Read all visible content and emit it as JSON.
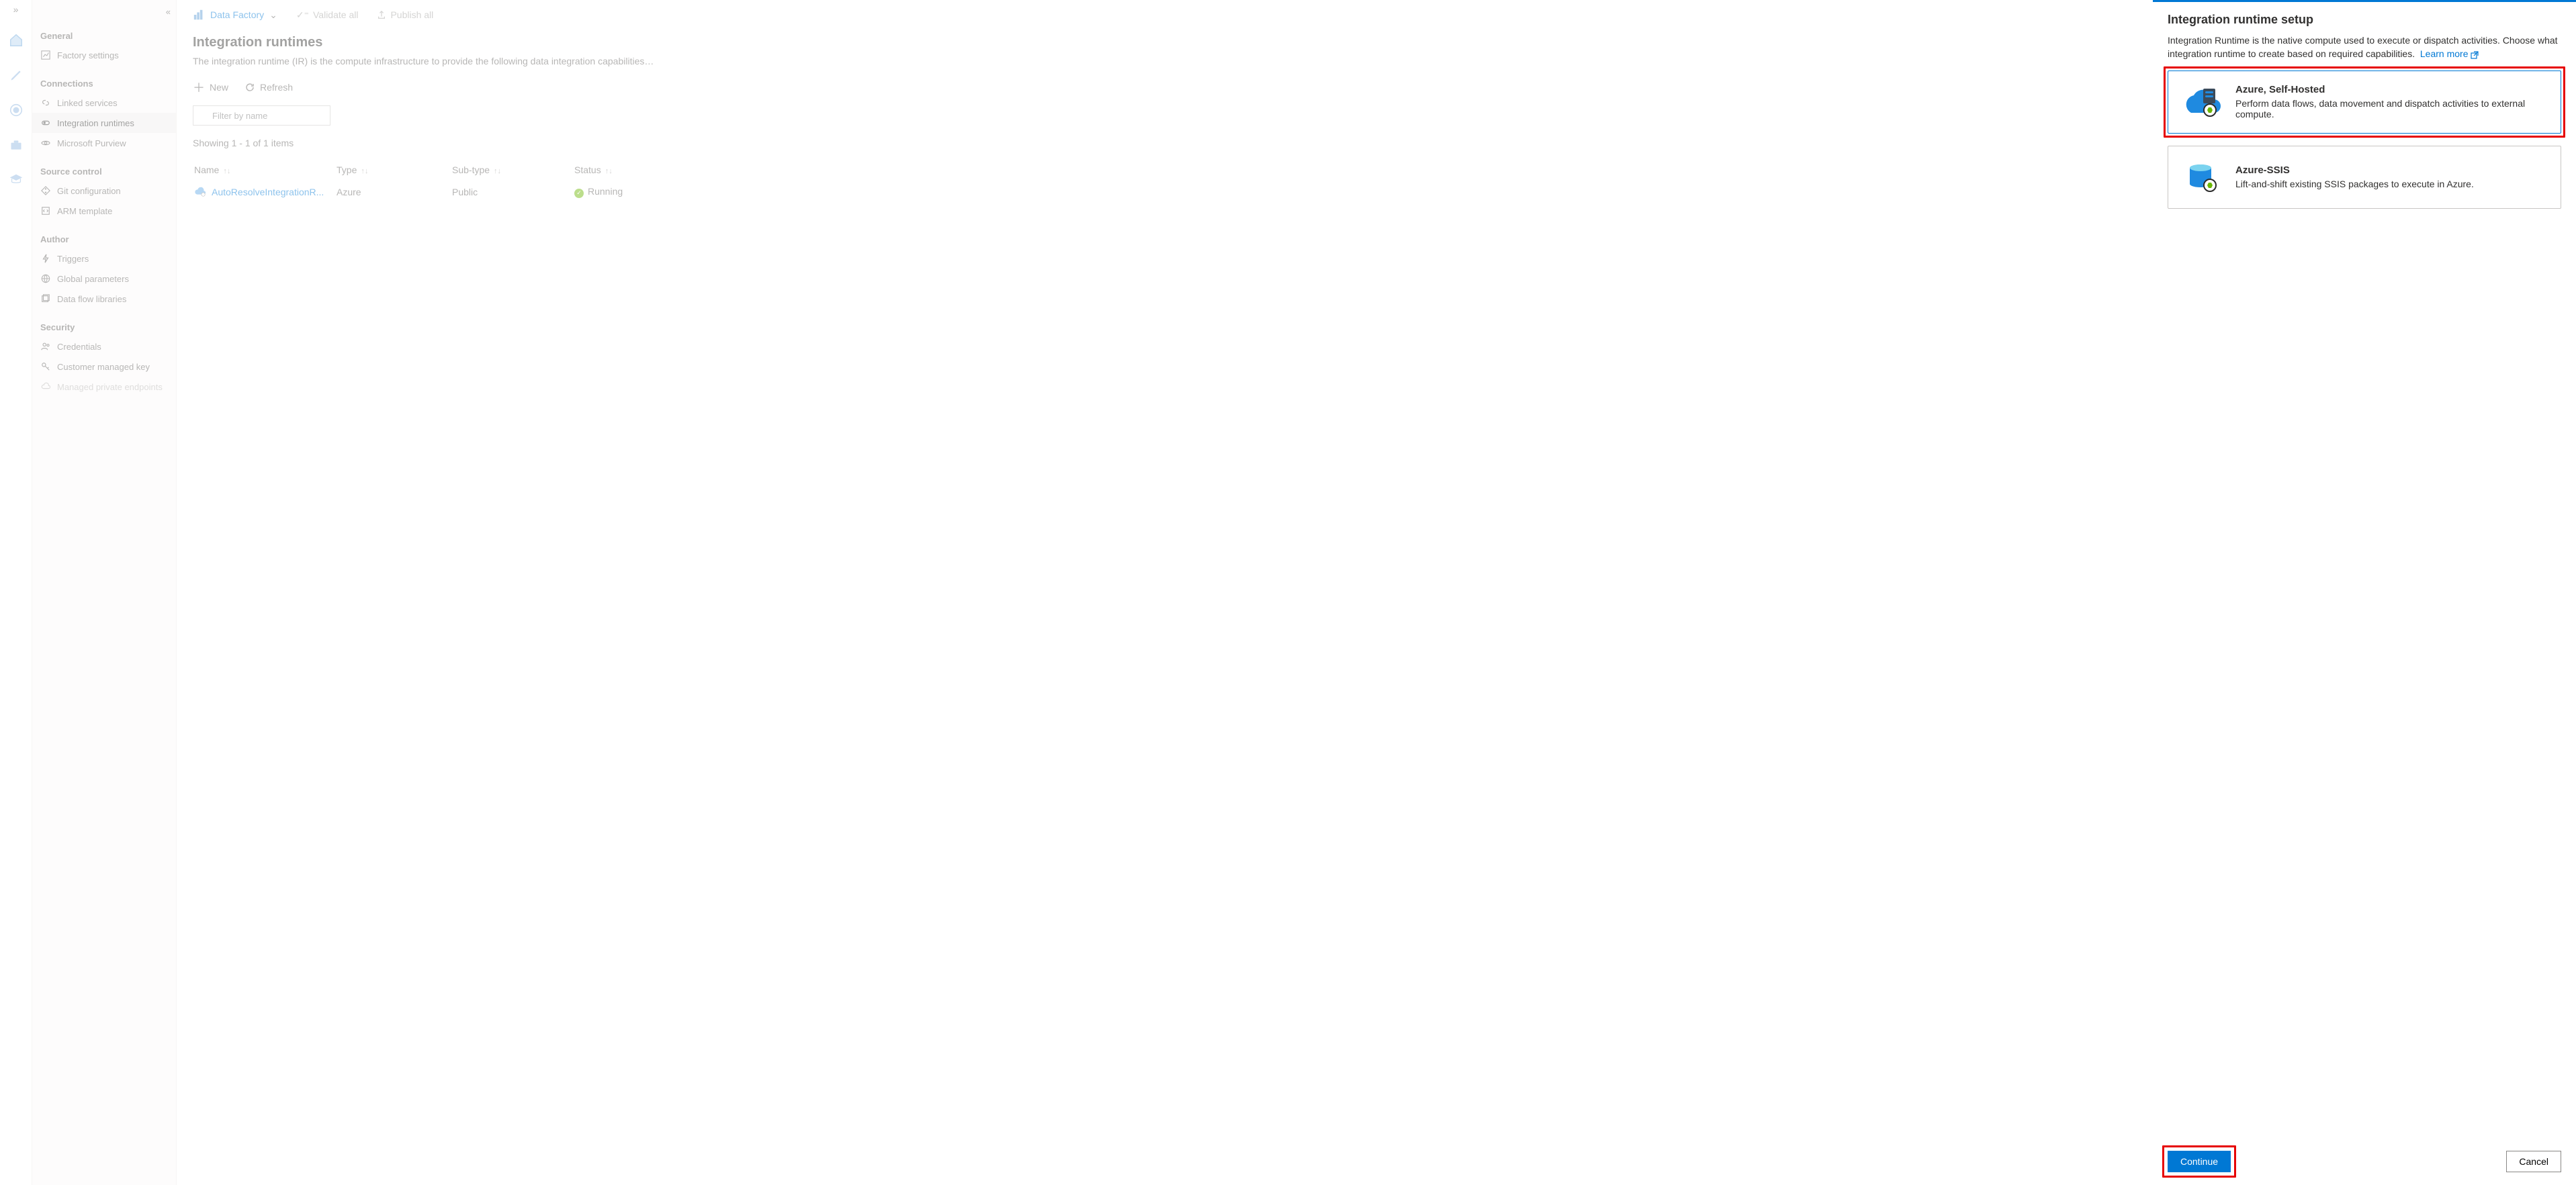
{
  "topbar": {
    "brand": "Data Factory",
    "validate": "Validate all",
    "publish": "Publish all"
  },
  "sidebar": {
    "groups": [
      {
        "header": "General",
        "items": [
          {
            "label": "Factory settings"
          }
        ]
      },
      {
        "header": "Connections",
        "items": [
          {
            "label": "Linked services"
          },
          {
            "label": "Integration runtimes",
            "selected": true
          },
          {
            "label": "Microsoft Purview"
          }
        ]
      },
      {
        "header": "Source control",
        "items": [
          {
            "label": "Git configuration"
          },
          {
            "label": "ARM template"
          }
        ]
      },
      {
        "header": "Author",
        "items": [
          {
            "label": "Triggers"
          },
          {
            "label": "Global parameters"
          },
          {
            "label": "Data flow libraries"
          }
        ]
      },
      {
        "header": "Security",
        "items": [
          {
            "label": "Credentials"
          },
          {
            "label": "Customer managed key"
          },
          {
            "label": "Managed private endpoints",
            "disabled": true
          }
        ]
      }
    ]
  },
  "main": {
    "title": "Integration runtimes",
    "subtitle": "The integration runtime (IR) is the compute infrastructure to provide the following data integration capabilities…",
    "new": "New",
    "refresh": "Refresh",
    "filter_placeholder": "Filter by name",
    "showing": "Showing 1 - 1 of 1 items",
    "columns": {
      "name": "Name",
      "type": "Type",
      "subtype": "Sub-type",
      "status": "Status"
    },
    "row": {
      "name": "AutoResolveIntegrationR...",
      "type": "Azure",
      "subtype": "Public",
      "status": "Running"
    }
  },
  "panel": {
    "title": "Integration runtime setup",
    "desc_a": "Integration Runtime is the native compute used to execute or dispatch activities. Choose what integration runtime to create based on required capabilities.",
    "learn": "Learn more",
    "cards": [
      {
        "title": "Azure, Self-Hosted",
        "sub": "Perform data flows, data movement and dispatch activities to external compute."
      },
      {
        "title": "Azure-SSIS",
        "sub": "Lift-and-shift existing SSIS packages to execute in Azure."
      }
    ],
    "continue": "Continue",
    "cancel": "Cancel"
  }
}
